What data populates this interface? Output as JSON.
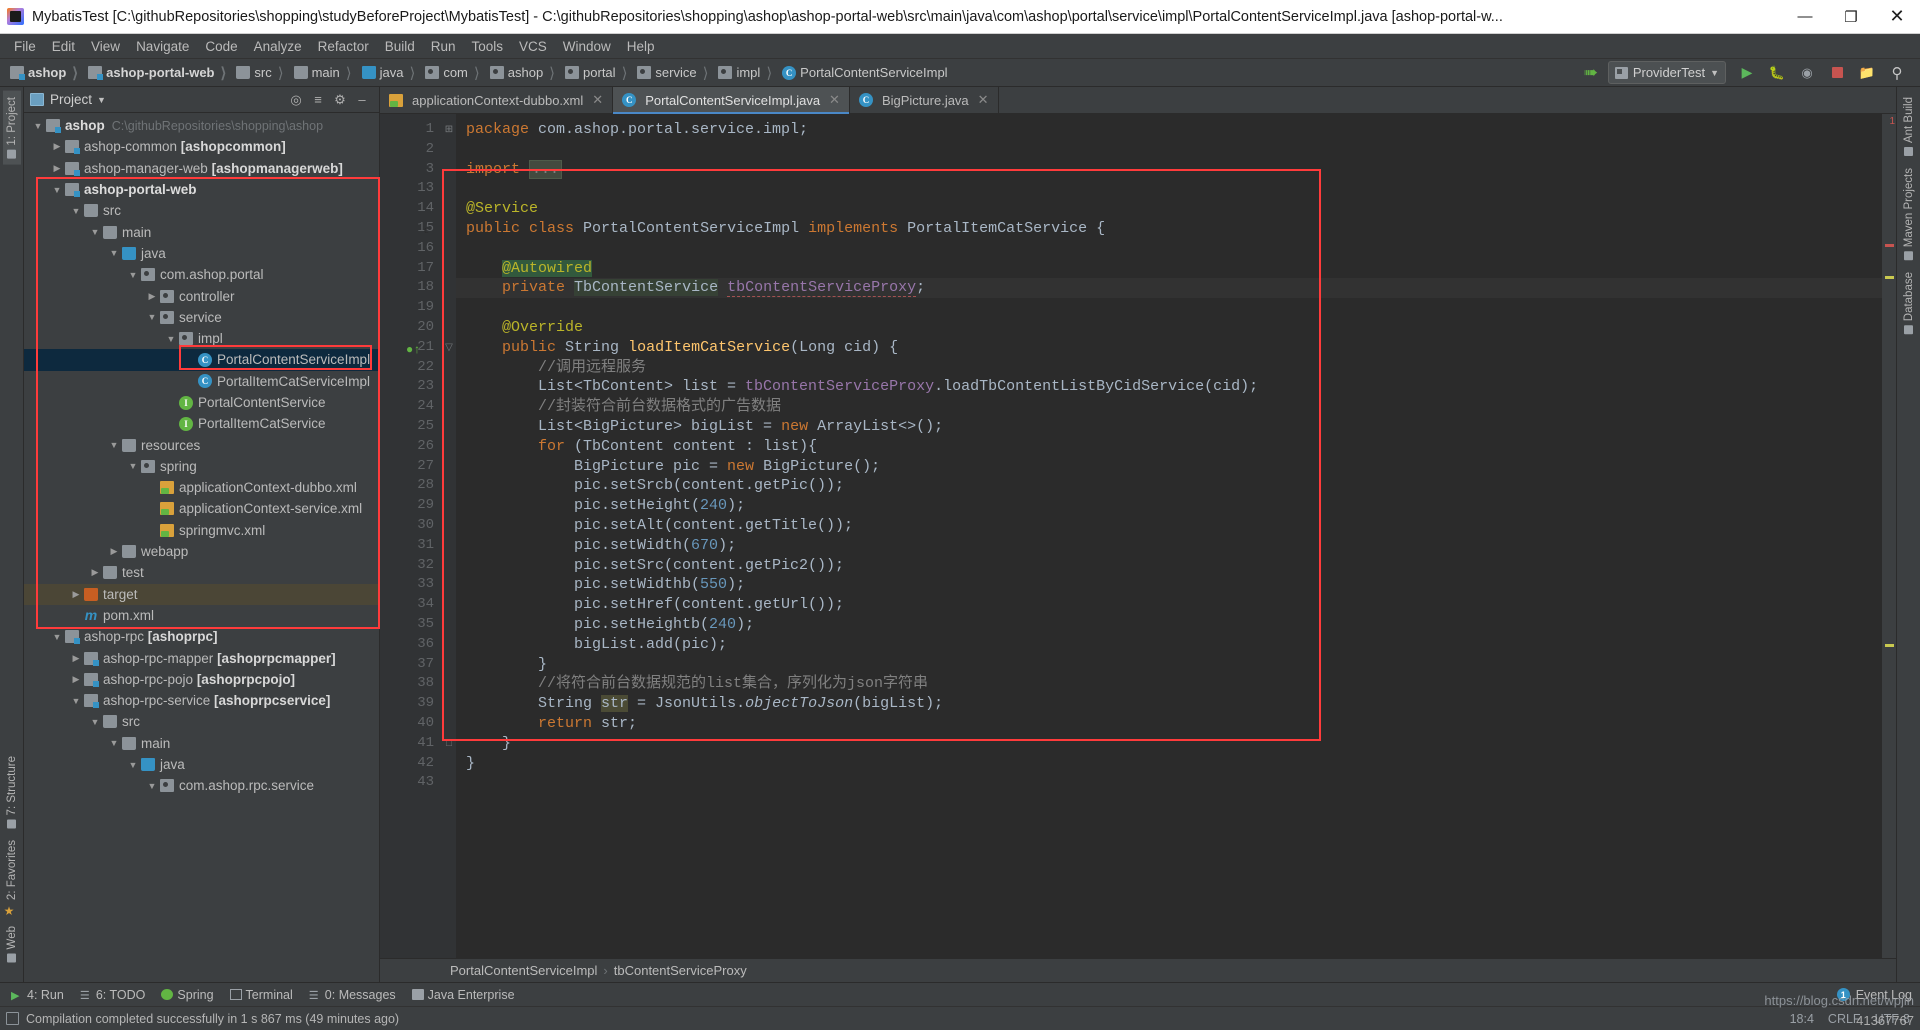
{
  "window": {
    "title": "MybatisTest [C:\\githubRepositories\\shopping\\studyBeforeProject\\MybatisTest] - C:\\githubRepositories\\shopping\\ashop\\ashop-portal-web\\src\\main\\java\\com\\ashop\\portal\\service\\impl\\PortalContentServiceImpl.java [ashop-portal-w...",
    "minimize": "—",
    "maximize": "❐",
    "close": "✕"
  },
  "menubar": [
    "File",
    "Edit",
    "View",
    "Navigate",
    "Code",
    "Analyze",
    "Refactor",
    "Build",
    "Run",
    "Tools",
    "VCS",
    "Window",
    "Help"
  ],
  "navbar": {
    "crumbs": [
      {
        "label": "ashop",
        "icon": "module-icon",
        "bold": true
      },
      {
        "label": "ashop-portal-web",
        "icon": "module-icon",
        "bold": true
      },
      {
        "label": "src",
        "icon": "folder-icon",
        "bold": false
      },
      {
        "label": "main",
        "icon": "folder-icon",
        "bold": false
      },
      {
        "label": "java",
        "icon": "source-folder-icon",
        "bold": false
      },
      {
        "label": "com",
        "icon": "package-icon",
        "bold": false
      },
      {
        "label": "ashop",
        "icon": "package-icon",
        "bold": false
      },
      {
        "label": "portal",
        "icon": "package-icon",
        "bold": false
      },
      {
        "label": "service",
        "icon": "package-icon",
        "bold": false
      },
      {
        "label": "impl",
        "icon": "package-icon",
        "bold": false
      },
      {
        "label": "PortalContentServiceImpl",
        "icon": "class-icon",
        "bold": false
      }
    ],
    "run_config": "ProviderTest",
    "icons": [
      "update-project-icon",
      "run-icon",
      "debug-icon",
      "run-coverage-icon",
      "stop-icon",
      "project-structure-icon",
      "search-everywhere-icon"
    ]
  },
  "left_stripe": [
    {
      "label": "1: Project",
      "active": true
    },
    {
      "label": "7: Structure",
      "active": false
    },
    {
      "label": "2: Favorites",
      "active": false
    },
    {
      "label": "Web",
      "active": false
    }
  ],
  "right_stripe": [
    {
      "label": "Ant Build"
    },
    {
      "label": "Maven Projects"
    },
    {
      "label": "Database"
    }
  ],
  "project_panel": {
    "title": "Project",
    "tools": [
      "target-icon",
      "collapse-all-icon",
      "settings-icon",
      "hide-icon"
    ],
    "tree": [
      {
        "depth": 0,
        "tw": "▼",
        "icon": "module-icon",
        "label": "ashop",
        "bold": true,
        "path": "C:\\githubRepositories\\shopping\\ashop"
      },
      {
        "depth": 1,
        "tw": "▶",
        "icon": "module-icon",
        "label": "ashop-common ",
        "suffix": "[ashopcommon]"
      },
      {
        "depth": 1,
        "tw": "▶",
        "icon": "module-icon",
        "label": "ashop-manager-web ",
        "suffix": "[ashopmanagerweb]"
      },
      {
        "depth": 1,
        "tw": "▼",
        "icon": "module-icon",
        "label": "ashop-portal-web",
        "bold": true
      },
      {
        "depth": 2,
        "tw": "▼",
        "icon": "folder-icon",
        "label": "src"
      },
      {
        "depth": 3,
        "tw": "▼",
        "icon": "folder-icon",
        "label": "main"
      },
      {
        "depth": 4,
        "tw": "▼",
        "icon": "source-folder-icon",
        "label": "java"
      },
      {
        "depth": 5,
        "tw": "▼",
        "icon": "package-icon",
        "label": "com.ashop.portal"
      },
      {
        "depth": 6,
        "tw": "▶",
        "icon": "package-icon",
        "label": "controller"
      },
      {
        "depth": 6,
        "tw": "▼",
        "icon": "package-icon",
        "label": "service"
      },
      {
        "depth": 7,
        "tw": "▼",
        "icon": "package-icon",
        "label": "impl"
      },
      {
        "depth": 8,
        "tw": "",
        "icon": "class-icon",
        "label": "PortalContentServiceImpl",
        "selected": true
      },
      {
        "depth": 8,
        "tw": "",
        "icon": "class-icon",
        "label": "PortalItemCatServiceImpl"
      },
      {
        "depth": 7,
        "tw": "",
        "icon": "interface-icon",
        "label": "PortalContentService"
      },
      {
        "depth": 7,
        "tw": "",
        "icon": "interface-icon",
        "label": "PortalItemCatService"
      },
      {
        "depth": 4,
        "tw": "▼",
        "icon": "resources-folder-icon",
        "label": "resources"
      },
      {
        "depth": 5,
        "tw": "▼",
        "icon": "package-icon",
        "label": "spring"
      },
      {
        "depth": 6,
        "tw": "",
        "icon": "xml-spring-icon",
        "label": "applicationContext-dubbo.xml"
      },
      {
        "depth": 6,
        "tw": "",
        "icon": "xml-spring-icon",
        "label": "applicationContext-service.xml"
      },
      {
        "depth": 6,
        "tw": "",
        "icon": "xml-spring-icon",
        "label": "springmvc.xml"
      },
      {
        "depth": 4,
        "tw": "▶",
        "icon": "webapp-folder-icon",
        "label": "webapp"
      },
      {
        "depth": 3,
        "tw": "▶",
        "icon": "folder-icon",
        "label": "test"
      },
      {
        "depth": 2,
        "tw": "▶",
        "icon": "target-folder-icon",
        "label": "target",
        "highlight": true
      },
      {
        "depth": 2,
        "tw": "",
        "icon": "maven-icon",
        "label": "pom.xml"
      },
      {
        "depth": 1,
        "tw": "▼",
        "icon": "module-icon",
        "label": "ashop-rpc ",
        "suffix": "[ashoprpc]"
      },
      {
        "depth": 2,
        "tw": "▶",
        "icon": "module-icon",
        "label": "ashop-rpc-mapper ",
        "suffix": "[ashoprpcmapper]"
      },
      {
        "depth": 2,
        "tw": "▶",
        "icon": "module-icon",
        "label": "ashop-rpc-pojo ",
        "suffix": "[ashoprpcpojo]"
      },
      {
        "depth": 2,
        "tw": "▼",
        "icon": "module-icon",
        "label": "ashop-rpc-service ",
        "suffix": "[ashoprpcservice]"
      },
      {
        "depth": 3,
        "tw": "▼",
        "icon": "folder-icon",
        "label": "src"
      },
      {
        "depth": 4,
        "tw": "▼",
        "icon": "folder-icon",
        "label": "main"
      },
      {
        "depth": 5,
        "tw": "▼",
        "icon": "source-folder-icon",
        "label": "java"
      },
      {
        "depth": 6,
        "tw": "▼",
        "icon": "package-icon",
        "label": "com.ashop.rpc.service"
      }
    ]
  },
  "editor": {
    "tabs": [
      {
        "label": "applicationContext-dubbo.xml",
        "icon": "xml-spring-icon",
        "active": false,
        "close": "✕"
      },
      {
        "label": "PortalContentServiceImpl.java",
        "icon": "class-icon",
        "active": true,
        "close": "✕"
      },
      {
        "label": "BigPicture.java",
        "icon": "class-icon",
        "active": false,
        "close": "✕"
      }
    ],
    "line_numbers": [
      "1",
      "2",
      "3",
      "13",
      "14",
      "15",
      "16",
      "17",
      "18",
      "19",
      "20",
      "21",
      "22",
      "23",
      "24",
      "25",
      "26",
      "27",
      "28",
      "29",
      "30",
      "31",
      "32",
      "33",
      "34",
      "35",
      "36",
      "37",
      "38",
      "39",
      "40",
      "41",
      "42",
      "43"
    ],
    "code_lines": [
      "package com.ashop.portal.service.impl;",
      "",
      "import ...",
      "",
      "@Service",
      "public class PortalContentServiceImpl implements PortalItemCatService {",
      "",
      "    @Autowired",
      "    private TbContentService tbContentServiceProxy;",
      "",
      "    @Override",
      "    public String loadItemCatService(Long cid) {",
      "        //调用远程服务",
      "        List<TbContent> list = tbContentServiceProxy.loadTbContentListByCidService(cid);",
      "        //封装符合前台数据格式的广告数据",
      "        List<BigPicture> bigList = new ArrayList<>();",
      "        for (TbContent content : list){",
      "            BigPicture pic = new BigPicture();",
      "            pic.setSrcb(content.getPic());",
      "            pic.setHeight(240);",
      "            pic.setAlt(content.getTitle());",
      "            pic.setWidth(670);",
      "            pic.setSrc(content.getPic2());",
      "            pic.setWidthb(550);",
      "            pic.setHref(content.getUrl());",
      "            pic.setHeightb(240);",
      "            bigList.add(pic);",
      "        }",
      "        //将符合前台数据规范的list集合，序列化为json字符串",
      "        String str = JsonUtils.objectToJson(bigList);",
      "        return str;",
      "    }",
      "}",
      ""
    ],
    "breadcrumb": [
      "PortalContentServiceImpl",
      "tbContentServiceProxy"
    ],
    "breadcrumb_sep": "›",
    "error_count": "1"
  },
  "bottom_bar": {
    "buttons": [
      {
        "label": "4: Run",
        "icon": "run-icon"
      },
      {
        "label": "6: TODO",
        "icon": "todo-icon"
      },
      {
        "label": "Spring",
        "icon": "spring-icon"
      },
      {
        "label": "Terminal",
        "icon": "terminal-icon"
      },
      {
        "label": "0: Messages",
        "icon": "messages-icon"
      },
      {
        "label": "Java Enterprise",
        "icon": "java-ee-icon"
      }
    ],
    "event_log": "Event Log",
    "event_count": "1"
  },
  "statusbar": {
    "message": "Compilation completed successfully in 1 s 867 ms (49 minutes ago)",
    "caret": "18:4",
    "line_sep": "CRLF",
    "encoding": "UTF-8",
    "watermark_url": "https://blog.csdn.net/wpjin",
    "watermark_id": "41367767"
  },
  "colors": {
    "accent": "#4a88c7",
    "annotation": "#bbb529",
    "keyword": "#cc7832",
    "string": "#6a8759",
    "number": "#6897bb",
    "comment": "#808080",
    "field": "#9876aa",
    "method": "#ffc66d",
    "annotation_box": "#ff3b3b",
    "selection": "#0d293e"
  }
}
